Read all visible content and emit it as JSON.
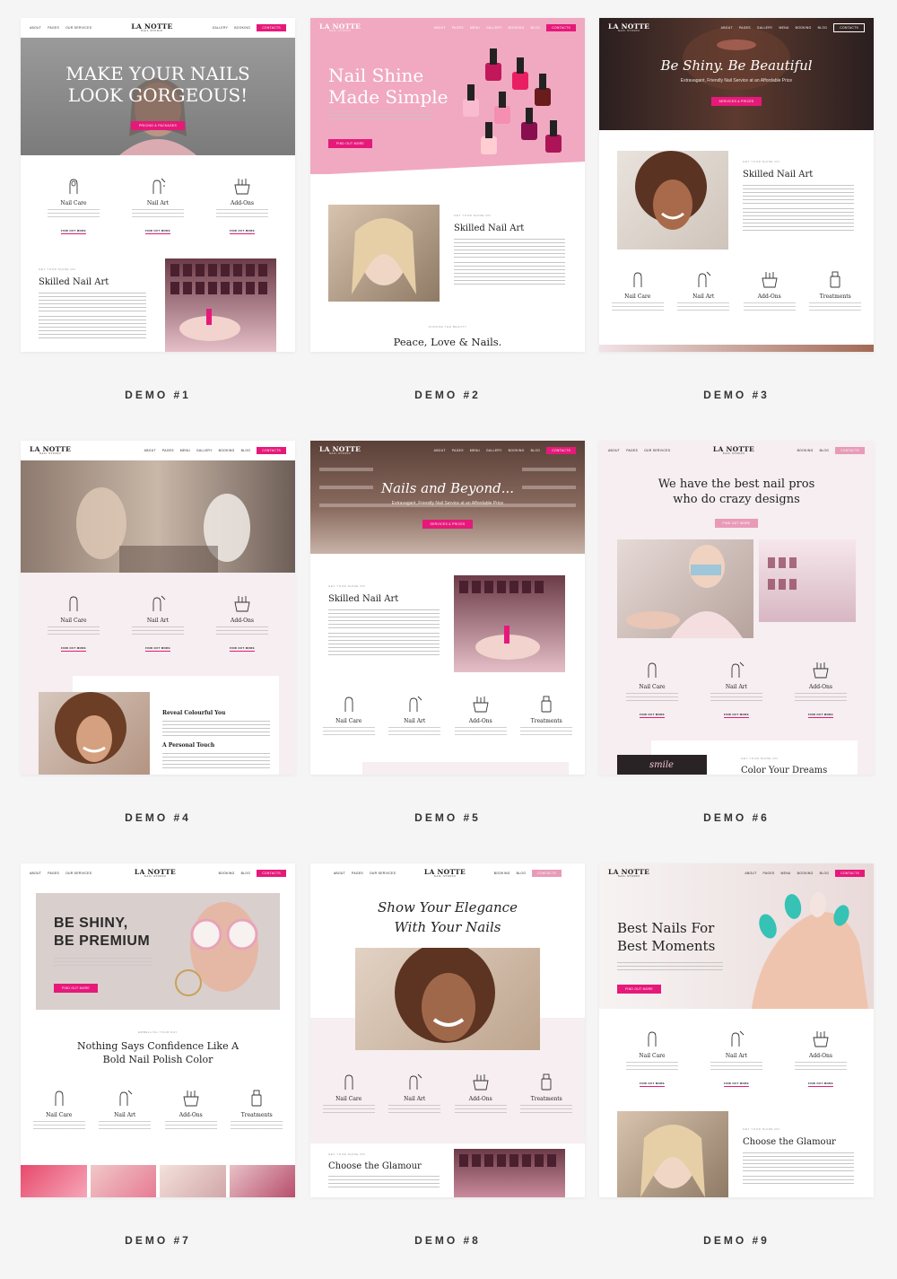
{
  "demos": [
    {
      "label": "DEMO #1"
    },
    {
      "label": "DEMO #2"
    },
    {
      "label": "DEMO #3"
    },
    {
      "label": "DEMO #4"
    },
    {
      "label": "DEMO #5"
    },
    {
      "label": "DEMO #6"
    },
    {
      "label": "DEMO #7"
    },
    {
      "label": "DEMO #8"
    },
    {
      "label": "DEMO #9"
    }
  ],
  "nav": {
    "logo": "LA NOTTE",
    "logo_sub": "NAIL STUDIO",
    "about": "ABOUT",
    "pages": "PAGES",
    "our_services": "OUR SERVICES",
    "gallery": "GALLERY",
    "booking": "BOOKING",
    "menu": "MENU",
    "blog": "BLOG",
    "contacts": "CONTACTS"
  },
  "services": {
    "nail_care": "Nail Care",
    "nail_art": "Nail Art",
    "add_ons": "Add-Ons",
    "treatments": "Treatments",
    "find_out_more": "FIND OUT MORE"
  },
  "demo1": {
    "hero_title_1": "MAKE YOUR NAILS",
    "hero_title_2": "LOOK GORGEOUS!",
    "hero_button": "PRICING & PACKAGES",
    "eyebrow": "GET YOUR SHINE ON",
    "section_title": "Skilled Nail Art"
  },
  "demo2": {
    "hero_title_1": "Nail Shine",
    "hero_title_2": "Made Simple",
    "hero_button": "FIND OUT MORE",
    "eyebrow": "GET YOUR SHINE ON",
    "section_title": "Skilled Nail Art",
    "footer_eyebrow": "CHOOSE THE BEAUTY",
    "footer_title": "Peace, Love & Nails."
  },
  "demo3": {
    "hero_title": "Be Shiny. Be Beautiful",
    "hero_sub": "Extravagant, Friendly Nail Service at an Affordable Price",
    "hero_button": "SERVICES & PRICES",
    "eyebrow": "GET YOUR SHINE ON",
    "section_title": "Skilled Nail Art"
  },
  "demo4": {
    "reveal": "Reveal Colourful You",
    "personal": "A Personal Touch"
  },
  "demo5": {
    "hero_title": "Nails and Beyond...",
    "hero_sub": "Extravagant, Friendly Nail Service at an Affordable Price",
    "hero_button": "SERVICES & PRICES",
    "eyebrow": "GET YOUR SHINE ON",
    "section_title": "Skilled Nail Art"
  },
  "demo6": {
    "hero_title_1": "We have the best nail pros",
    "hero_title_2": "who do crazy designs",
    "hero_button": "FIND OUT MORE",
    "eyebrow": "GET YOUR SHINE ON",
    "section_title": "Color Your Dreams",
    "smile": "smile"
  },
  "demo7": {
    "hero_title_1": "BE SHINY,",
    "hero_title_2": "BE PREMIUM",
    "hero_button": "FIND OUT MORE",
    "eyebrow": "EMBELLISH YOUR DAY",
    "section_title_1": "Nothing Says Confidence Like A",
    "section_title_2": "Bold Nail Polish Color"
  },
  "demo8": {
    "hero_title_1": "Show Your Elegance",
    "hero_title_2": "With Your Nails",
    "eyebrow": "GET YOUR SHINE ON",
    "section_title": "Choose the Glamour"
  },
  "demo9": {
    "hero_title_1": "Best Nails For",
    "hero_title_2": "Best Moments",
    "hero_button": "FIND OUT MORE",
    "eyebrow": "GET YOUR SHINE ON",
    "section_title": "Choose the Glamour"
  }
}
